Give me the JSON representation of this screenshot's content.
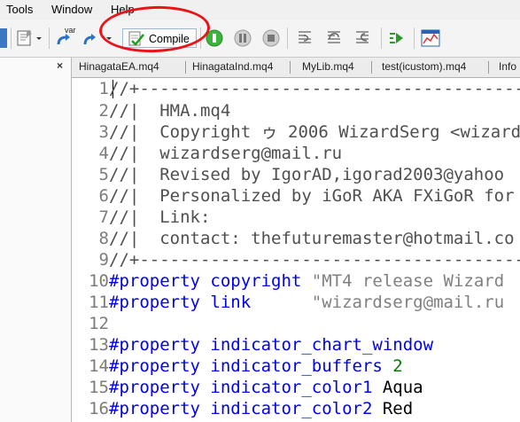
{
  "menu": {
    "tools": "Tools",
    "window": "Window",
    "help": "Help"
  },
  "toolbar": {
    "compile_label": "Compile",
    "var_label": "var"
  },
  "tabs": [
    {
      "label": "HinagataEA.mq4"
    },
    {
      "label": "HinagataInd.mq4"
    },
    {
      "label": "MyLib.mq4"
    },
    {
      "label": "test(icustom).mq4"
    },
    {
      "label": "Info"
    }
  ],
  "panel": {
    "close_glyph": "×"
  },
  "editor": {
    "lines": [
      {
        "num": "1",
        "text": "//+---------------------------------------"
      },
      {
        "num": "2",
        "text": "//|  HMA.mq4"
      },
      {
        "num": "3",
        "text": "//|  Copyright ゥ 2006 WizardSerg <wizard"
      },
      {
        "num": "4",
        "text": "//|  wizardserg@mail.ru"
      },
      {
        "num": "5",
        "text": "//|  Revised by IgorAD,igorad2003@yahoo"
      },
      {
        "num": "6",
        "text": "//|  Personalized by iGoR AKA FXiGoR for"
      },
      {
        "num": "7",
        "text": "//|  Link:"
      },
      {
        "num": "8",
        "text": "//|  contact: thefuturemaster@hotmail.co"
      },
      {
        "num": "9",
        "text": "//+---------------------------------------"
      },
      {
        "num": "10",
        "kw": "#property",
        "prop": " copyright ",
        "val": "\"MT4 release Wizard"
      },
      {
        "num": "11",
        "kw": "#property",
        "prop": " link      ",
        "val": "\"wizardserg@mail.ru"
      },
      {
        "num": "12"
      },
      {
        "num": "13",
        "kw": "#property",
        "prop": " indicator_chart_window"
      },
      {
        "num": "14",
        "kw": "#property",
        "prop": " indicator_buffers ",
        "val": "2"
      },
      {
        "num": "15",
        "kw": "#property",
        "prop": " indicator_color1 ",
        "val": "Aqua"
      },
      {
        "num": "16",
        "kw": "#property",
        "prop": " indicator_color2 ",
        "val": "Red"
      }
    ]
  },
  "colors": {
    "keyword": "#0000ee",
    "comment": "#4f4f4f",
    "string": "#808080",
    "number": "#008000",
    "highlight_circle": "#e81418"
  }
}
